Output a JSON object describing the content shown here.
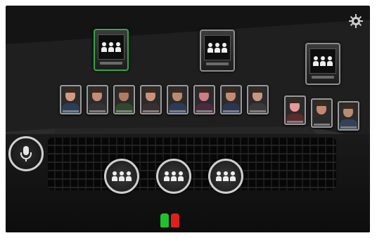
{
  "app": {
    "accent_selected": "#2fa84a",
    "background": "#141414"
  },
  "groups": [
    {
      "id": "group-1",
      "selected": true
    },
    {
      "id": "group-2",
      "selected": false
    },
    {
      "id": "group-3",
      "selected": false
    }
  ],
  "participants_row1": [
    {
      "skin": "#d39a83",
      "shirt": "#2b3d5b"
    },
    {
      "skin": "#c58c76",
      "shirt": "#333333"
    },
    {
      "skin": "#b07b63",
      "shirt": "#2e4a2a"
    },
    {
      "skin": "#c9927a",
      "shirt": "#3b2e2e"
    },
    {
      "skin": "#b88b72",
      "shirt": "#2c3c58"
    },
    {
      "skin": "#d07b86",
      "shirt": "#4a2b3e"
    },
    {
      "skin": "#c28c74",
      "shirt": "#2b3555"
    },
    {
      "skin": "#c69680",
      "shirt": "#3a3a3a"
    }
  ],
  "participants_row2": [
    {
      "skin": "#e59a9a",
      "shirt": "#5a2b2b"
    },
    {
      "skin": "#c08a70",
      "shirt": "#2a2a2a"
    },
    {
      "skin": "#b88c74",
      "shirt": "#33425a"
    }
  ],
  "audience_buttons": [
    {
      "id": "audience-1"
    },
    {
      "id": "audience-2"
    },
    {
      "id": "audience-3"
    }
  ],
  "status_indicators": {
    "green": "#22c02a",
    "red": "#e0201c"
  },
  "icons": {
    "settings": "gear-icon",
    "microphone": "microphone-icon",
    "group": "group-people-icon"
  }
}
